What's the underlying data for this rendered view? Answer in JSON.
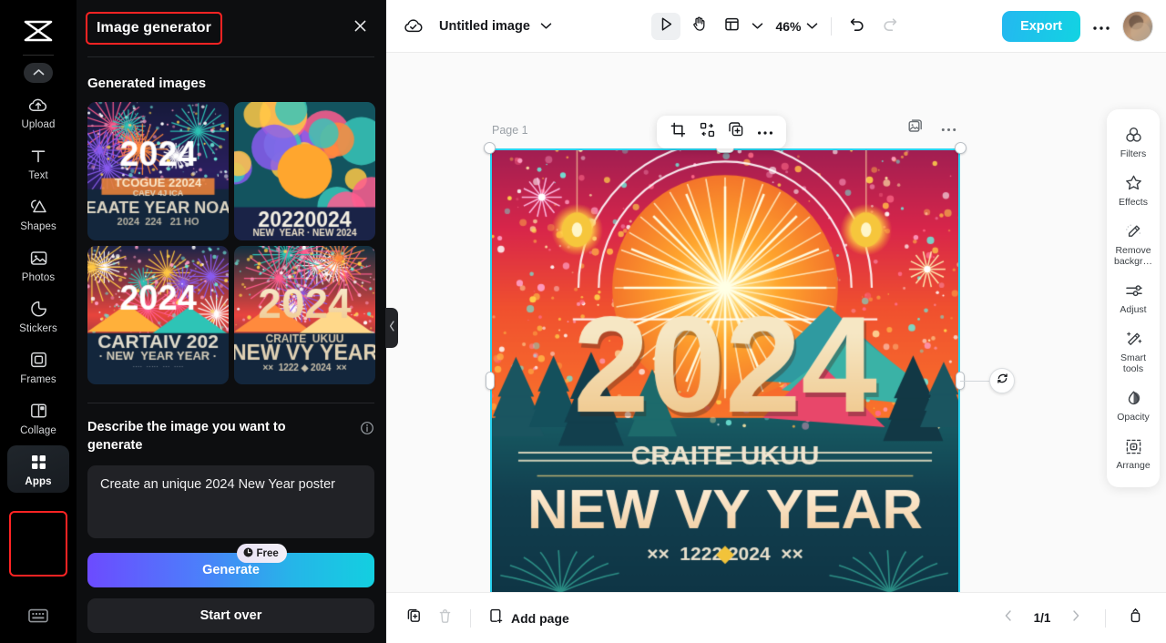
{
  "rail": {
    "logo": "capcut-logo",
    "collapse_icon": "chevron-up-icon",
    "keyboard_icon": "keyboard-icon",
    "items": [
      {
        "label": "Upload",
        "icon": "cloud-upload-icon",
        "selected": false
      },
      {
        "label": "Text",
        "icon": "text-t-icon",
        "selected": false
      },
      {
        "label": "Shapes",
        "icon": "shapes-icon",
        "selected": false
      },
      {
        "label": "Photos",
        "icon": "photo-icon",
        "selected": false
      },
      {
        "label": "Stickers",
        "icon": "sticker-icon",
        "selected": false
      },
      {
        "label": "Frames",
        "icon": "frame-icon",
        "selected": false
      },
      {
        "label": "Collage",
        "icon": "collage-icon",
        "selected": false
      },
      {
        "label": "Apps",
        "icon": "apps-grid-icon",
        "selected": true
      }
    ]
  },
  "panel": {
    "title": "Image generator",
    "close_icon": "close-icon",
    "section_title": "Generated images",
    "collapse_tab_icon": "chevron-left-icon",
    "thumbnails": [
      {
        "name": "generated-image-1",
        "caption": "2024 fireworks poster"
      },
      {
        "name": "generated-image-2",
        "caption": "2022 0024 ornament poster"
      },
      {
        "name": "generated-image-3",
        "caption": "2024 CARTAIV 202 New Year Year"
      },
      {
        "name": "generated-image-4",
        "caption": "2024 CRAITE UKUU NEW VY YEAR"
      }
    ],
    "prompt_label": "Describe the image you want to generate",
    "info_icon": "info-icon",
    "prompt_value": "Create an unique 2024 New Year poster",
    "prompt_placeholder": "Describe the image you want to generate",
    "generate_label": "Generate",
    "free_badge": "Free",
    "free_badge_icon": "clock-icon",
    "start_over_label": "Start over"
  },
  "topbar": {
    "cloud_icon": "cloud-saved-icon",
    "doc_title": "Untitled image",
    "title_chevron_icon": "chevron-down-icon",
    "tools": [
      {
        "name": "select-tool",
        "icon": "cursor-arrow-icon",
        "active": true
      },
      {
        "name": "hand-tool",
        "icon": "hand-icon",
        "active": false
      },
      {
        "name": "layout-tool",
        "icon": "layout-panel-icon",
        "active": false
      }
    ],
    "layout_chevron_icon": "chevron-down-icon",
    "zoom_level": "46%",
    "zoom_chevron_icon": "chevron-down-icon",
    "undo_icon": "undo-icon",
    "redo_icon": "redo-icon",
    "export_label": "Export",
    "more_icon": "more-horizontal-icon",
    "avatar": "user-avatar"
  },
  "canvas": {
    "page_label": "Page 1",
    "selection_color": "#2ad2f0",
    "rotate_icon": "rotate-icon",
    "float_toolbar": [
      {
        "name": "crop-button",
        "icon": "crop-icon"
      },
      {
        "name": "replace-button",
        "icon": "replace-shapes-icon"
      },
      {
        "name": "duplicate-button",
        "icon": "duplicate-plus-icon"
      },
      {
        "name": "more-button",
        "icon": "more-horizontal-icon"
      }
    ],
    "corner_tools": [
      {
        "name": "image-layers-button",
        "icon": "image-stack-icon"
      },
      {
        "name": "page-more-button",
        "icon": "more-horizontal-icon"
      }
    ],
    "artwork": {
      "headline": "2024",
      "subtitle": "CRAITE UKUU",
      "title": "NEW VY YEAR",
      "footer": "1222 2024"
    }
  },
  "dock": {
    "items": [
      {
        "label": "Filters",
        "icon": "filters-circles-icon"
      },
      {
        "label": "Effects",
        "icon": "effects-star-icon"
      },
      {
        "label": "Remove backgr…",
        "icon": "remove-background-icon"
      },
      {
        "label": "Adjust",
        "icon": "adjust-sliders-icon"
      },
      {
        "label": "Smart tools",
        "icon": "magic-wand-icon"
      },
      {
        "label": "Opacity",
        "icon": "opacity-drop-icon"
      },
      {
        "label": "Arrange",
        "icon": "arrange-icon"
      }
    ]
  },
  "bottombar": {
    "duplicate_page_icon": "duplicate-page-icon",
    "delete_page_icon": "trash-icon",
    "add_page_icon": "add-page-icon",
    "add_page_label": "Add page",
    "prev_icon": "chevron-left-icon",
    "page_indicator": "1/1",
    "next_icon": "chevron-right-icon",
    "expand_icon": "expand-up-icon"
  },
  "colors": {
    "accent_cyan": "#2ad2f0",
    "highlight_red": "#ff2323",
    "panel_bg": "#0d0e10",
    "rail_bg": "#000000"
  }
}
